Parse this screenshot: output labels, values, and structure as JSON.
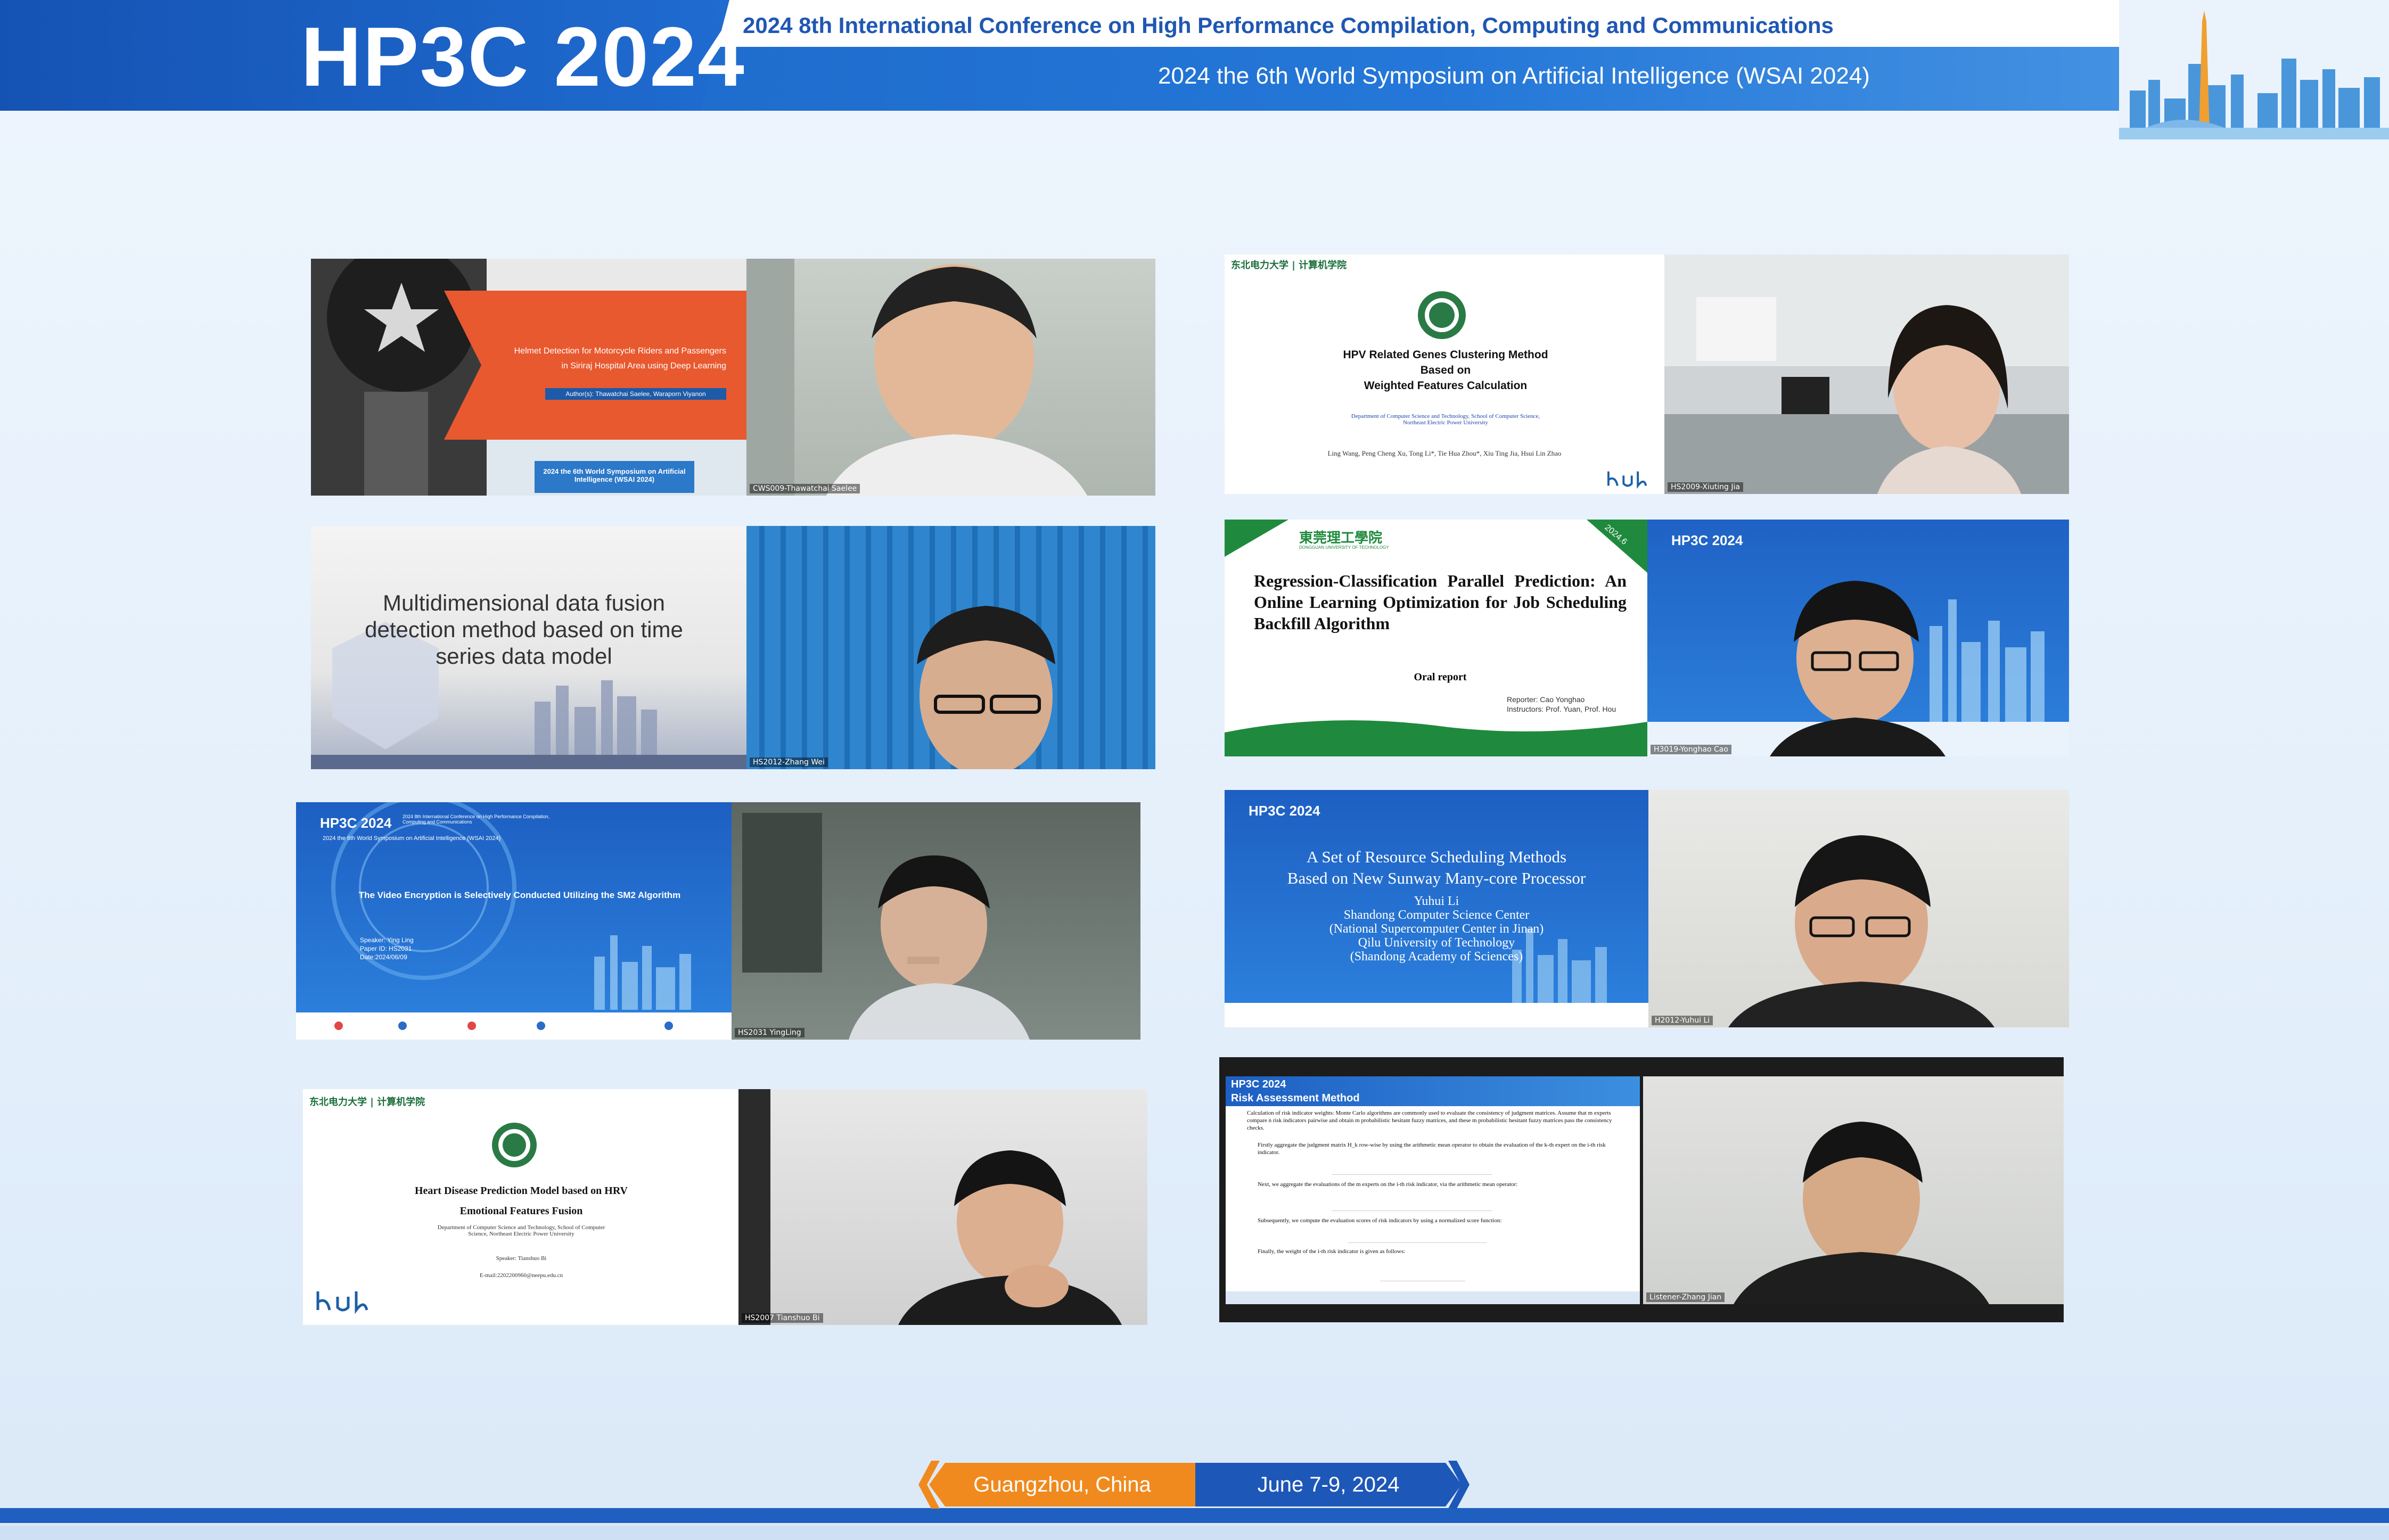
{
  "header": {
    "logo": "HP3C 2024",
    "line1": "2024 8th International Conference on High Performance Compilation, Computing and Communications",
    "line2": "2024 the 6th World Symposium on Artificial Intelligence (WSAI 2024)"
  },
  "tiles": [
    {
      "id": "cws009",
      "participant": "CWS009-Thawatchai Saelee",
      "slide": {
        "title": "Helmet Detection for Motorcycle Riders and Passengers in Siriraj Hospital Area using Deep Learning",
        "authors": "Author(s): Thawatchai Saelee, Waraporn Viyanon",
        "footer": "2024 the 6th World Symposium on Artificial Intelligence (WSAI 2024)"
      }
    },
    {
      "id": "hs2012",
      "participant": "HS2012-Zhang Wei",
      "slide": {
        "title": "Multidimensional data fusion detection method based on time series data model"
      }
    },
    {
      "id": "hs2031",
      "participant": "HS2031 YingLing",
      "slide": {
        "mini_logo": "HP3C 2024",
        "mini_line1": "2024 8th International Conference on High Performance Compilation, Computing and Communications",
        "mini_line2": "2024 the 6th World Symposium on Artificial Intelligence (WSAI 2024)",
        "title": "The Video Encryption is Selectively Conducted Utilizing the SM2 Algorithm",
        "speaker": "Speaker: Ying Ling",
        "paper": "Paper ID: HS2031",
        "date": "Date:2024/06/09"
      }
    },
    {
      "id": "hs2007",
      "participant": "HS2007 Tianshuo Bi",
      "slide": {
        "university": "东北电力大学 | 计算机学院",
        "title_line1": "Heart Disease Prediction Model based on HRV",
        "title_line2": "Emotional Features Fusion",
        "dept": "Department of Computer Science and Technology, School of Computer Science, Northeast Electric Power University",
        "speaker": "Speaker:  Tianshuo Bi",
        "email": "E-mail:2202200960@neepu.edu.cn"
      }
    },
    {
      "id": "hs2009",
      "participant": "HS2009-Xiuting Jia",
      "slide": {
        "university": "东北电力大学 | 计算机学院",
        "title_line1": "HPV Related Genes Clustering Method",
        "title_line2": "Based on",
        "title_line3": "Weighted Features Calculation",
        "dept": "Department of Computer Science and Technology, School of Computer Science, Northeast Electric Power University",
        "authors": "Ling Wang, Peng Cheng Xu, Tong Li*, Tie Hua Zhou*, Xiu Ting Jia, Hsui Lin Zhao"
      }
    },
    {
      "id": "h3019",
      "participant": "H3019-Yonghao Cao",
      "slide": {
        "university": "東莞理工學院",
        "university_en": "DONGGUAN UNIVERSITY OF TECHNOLOGY",
        "corner": "2024.6",
        "title": "Regression-Classification Parallel Prediction: An Online Learning Optimization for Job Scheduling Backfill Algorithm",
        "subtitle": "Oral report",
        "reporter": "Reporter: Cao Yonghao",
        "instructors": "Instructors: Prof. Yuan, Prof. Hou"
      }
    },
    {
      "id": "h2012",
      "participant": "H2012-Yuhui Li",
      "slide": {
        "mini_logo": "HP3C 2024",
        "title_line1": "A Set of Resource Scheduling Methods",
        "title_line2": "Based on New Sunway Many-core Processor",
        "name": "Yuhui Li",
        "aff1": "Shandong Computer Science Center",
        "aff2": "(National Supercomputer Center in Jinan)",
        "aff3": "Qilu University of Technology",
        "aff4": "(Shandong Academy of Sciences)"
      }
    },
    {
      "id": "listener",
      "participant": "Listener-Zhang Jian",
      "slide": {
        "mini_logo": "HP3C 2024",
        "section": "Risk Assessment Method",
        "p1": "Calculation of risk indicator weights: Monte Carlo algorithms are commonly used to evaluate the consistency of judgment matrices. Assume that m experts compare n risk indicators pairwise and obtain m probabilistic hesitant fuzzy matrices, and these m probabilistic hesitant fuzzy matrices pass the consistency checks.",
        "b1": "Firstly aggregate the judgment matrix H_k row-wise by using the arithmetic mean operator to obtain the evaluation of the k-th expert on the i-th risk indicator.",
        "b2": "Next, we aggregate the evaluations of the m experts on the i-th risk indicator, via the arithmetic mean operator:",
        "b3": "Subsequently, we compute the evaluation scores of risk indicators by using a normalized score function:",
        "b4": "Finally, the weight of the i-th risk indicator is given as follows:"
      }
    }
  ],
  "footer": {
    "city": "Guangzhou, China",
    "date": "June 7-9, 2024"
  }
}
